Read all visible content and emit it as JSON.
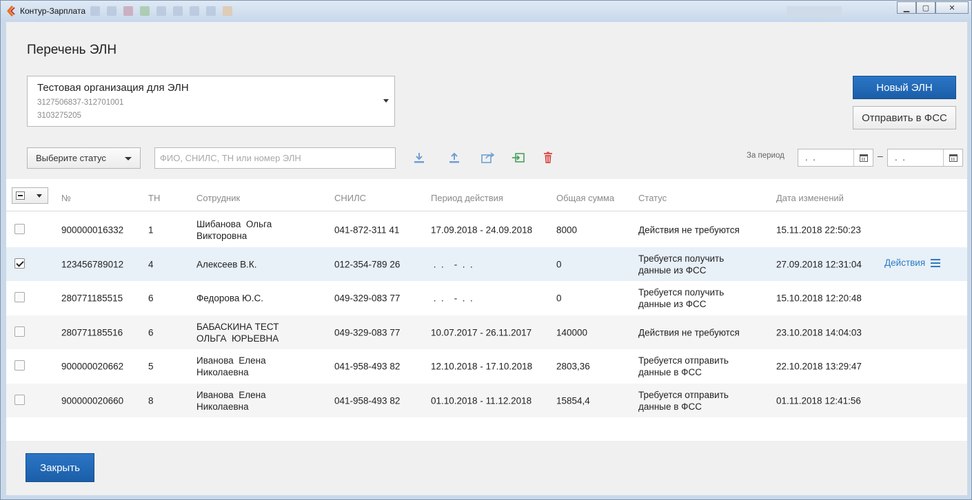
{
  "window": {
    "title": "Контур-Зарплата",
    "controls": {
      "minimize": "▁",
      "maximize": "▢",
      "close": "✕"
    }
  },
  "page": {
    "title": "Перечень ЭЛН"
  },
  "organization": {
    "name": "Тестовая организация для ЭЛН",
    "code1": "3127506837-312701001",
    "code2": "3103275205"
  },
  "buttons": {
    "new_eln": "Новый ЭЛН",
    "send_fss": "Отправить в ФСС",
    "close": "Закрыть"
  },
  "filters": {
    "status_label": "Выберите статус",
    "search_placeholder": "ФИО, СНИЛС, ТН или номер ЭЛН",
    "search_value": "",
    "period_label": "За период",
    "date_from": ". .",
    "date_to": ". .",
    "date_separator": "–"
  },
  "toolbar_icons": [
    "download-icon",
    "upload-icon",
    "export-icon",
    "import-icon",
    "delete-icon"
  ],
  "colors": {
    "accent": "#1f66b3",
    "link": "#2d7bc4",
    "icon_blue": "#6f9fd6",
    "icon_green": "#4aa05a",
    "icon_red": "#d9534f",
    "row_selected": "#e8f0f8"
  },
  "table": {
    "columns": [
      "№",
      "ТН",
      "Сотрудник",
      "СНИЛС",
      "Период действия",
      "Общая сумма",
      "Статус",
      "Дата изменений"
    ],
    "rows": [
      {
        "checked": false,
        "number": "900000016332",
        "tn": "1",
        "employee": "Шибанова  Ольга\nВикторовна",
        "snils": "041-872-311 41",
        "period": "17.09.2018 - 24.09.2018",
        "sum": "8000",
        "status": "Действия не требуются",
        "changed": "15.11.2018 22:50:23",
        "actions": ""
      },
      {
        "checked": true,
        "number": "123456789012",
        "tn": "4",
        "employee": "Алексеев В.К.",
        "snils": "012-354-789 26",
        "period": " .  .    -  .  .",
        "sum": "0",
        "status": "Требуется получить\nданные из ФСС",
        "changed": "27.09.2018 12:31:04",
        "actions": "Действия"
      },
      {
        "checked": false,
        "number": "280771185515",
        "tn": "6",
        "employee": "Федорова Ю.С.",
        "snils": "049-329-083 77",
        "period": " .  .    -  .  .",
        "sum": "0",
        "status": "Требуется получить\nданные из ФСС",
        "changed": "15.10.2018 12:20:48",
        "actions": ""
      },
      {
        "checked": false,
        "number": "280771185516",
        "tn": "6",
        "employee": "БАБАСКИНА ТЕСТ\nОЛЬГА  ЮРЬЕВНА",
        "snils": "049-329-083 77",
        "period": "10.07.2017 - 26.11.2017",
        "sum": "140000",
        "status": "Действия не требуются",
        "changed": "23.10.2018 14:04:03",
        "actions": ""
      },
      {
        "checked": false,
        "number": "900000020662",
        "tn": "5",
        "employee": "Иванова  Елена\nНиколаевна",
        "snils": "041-958-493 82",
        "period": "12.10.2018 - 17.10.2018",
        "sum": "2803,36",
        "status": "Требуется отправить\nданные в ФСС",
        "changed": "22.10.2018 13:29:47",
        "actions": ""
      },
      {
        "checked": false,
        "number": "900000020660",
        "tn": "8",
        "employee": "Иванова  Елена\nНиколаевна",
        "snils": "041-958-493 82",
        "period": "01.10.2018 - 11.12.2018",
        "sum": "15854,4",
        "status": "Требуется отправить\nданные в ФСС",
        "changed": "01.11.2018 12:41:56",
        "actions": ""
      }
    ]
  }
}
